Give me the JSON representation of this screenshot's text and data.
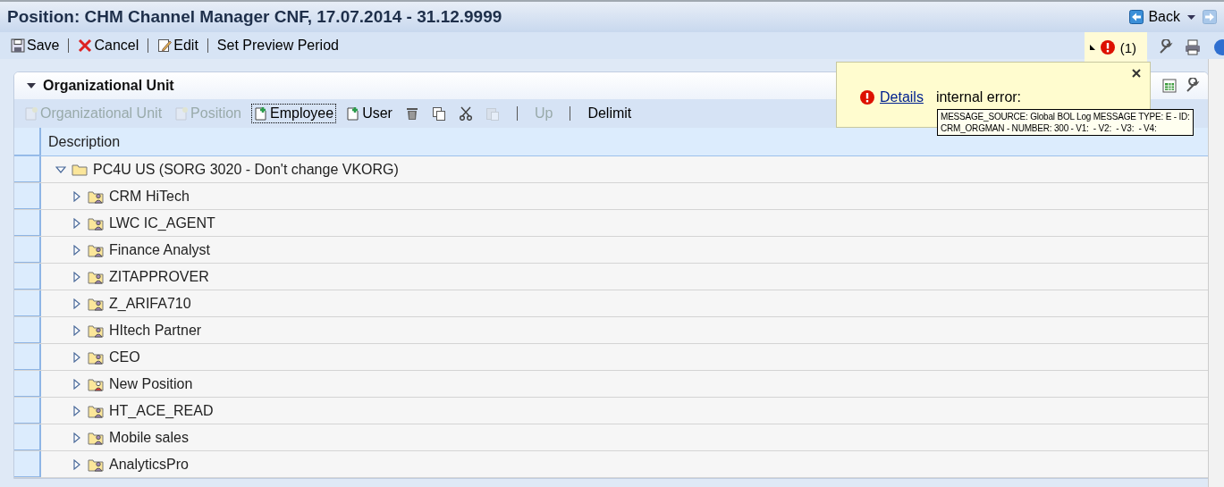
{
  "window": {
    "title": "Position: CHM Channel Manager CNF, 17.07.2014 - 31.12.9999",
    "back": "Back"
  },
  "toolbar": [
    {
      "kind": "save",
      "label": "Save"
    },
    {
      "kind": "cancel",
      "label": "Cancel"
    },
    {
      "kind": "edit",
      "label": "Edit"
    },
    {
      "kind": "none",
      "label": "Set Preview Period"
    }
  ],
  "messages": {
    "count": "(1)"
  },
  "panel": {
    "title": "Organizational Unit",
    "expanded": true,
    "actions": [
      {
        "kind": "new",
        "label": "Organizational Unit",
        "disabled": true,
        "focused": false
      },
      {
        "kind": "new",
        "label": "Position",
        "disabled": true,
        "focused": false
      },
      {
        "kind": "add",
        "label": "Employee",
        "disabled": false,
        "focused": true
      },
      {
        "kind": "add",
        "label": "User",
        "disabled": false,
        "focused": false
      },
      {
        "kind": "trash",
        "disabled": false,
        "focused": false
      },
      {
        "kind": "copy",
        "disabled": false,
        "focused": false
      },
      {
        "kind": "cut",
        "disabled": false,
        "focused": false
      },
      {
        "kind": "paste",
        "disabled": true,
        "focused": false
      },
      {
        "kind": "sep"
      },
      {
        "kind": "text",
        "label": "Up",
        "disabled": true,
        "focused": false
      },
      {
        "kind": "sep"
      },
      {
        "kind": "text",
        "label": "Delimit",
        "disabled": false,
        "focused": false
      }
    ],
    "table": {
      "columns": [
        "Description"
      ],
      "tree": [
        {
          "label": "PC4U US (SORG 3020 - Don't change VKORG)",
          "kind": "org",
          "expanded": true,
          "children": [
            {
              "label": "CRM HiTech",
              "kind": "position",
              "expanded": false
            },
            {
              "label": "LWC IC_AGENT",
              "kind": "position",
              "expanded": false
            },
            {
              "label": "Finance Analyst",
              "kind": "position",
              "expanded": false
            },
            {
              "label": "ZITAPPROVER",
              "kind": "position",
              "expanded": false
            },
            {
              "label": "Z_ARIFA710",
              "kind": "position",
              "expanded": false
            },
            {
              "label": "HItech Partner",
              "kind": "position",
              "expanded": false
            },
            {
              "label": "CEO",
              "kind": "position",
              "expanded": false
            },
            {
              "label": "New Position",
              "kind": "vacant",
              "expanded": false
            },
            {
              "label": "HT_ACE_READ",
              "kind": "position",
              "expanded": false
            },
            {
              "label": "Mobile sales",
              "kind": "position",
              "expanded": false
            },
            {
              "label": "AnalyticsPro",
              "kind": "position",
              "expanded": false
            }
          ]
        }
      ]
    }
  },
  "popup": {
    "link": "Details",
    "text": "internal error:",
    "tooltip": [
      "MESSAGE_SOURCE: Global BOL Log MESSAGE TYPE: E - ID:",
      "CRM_ORGMAN - NUMBER: 300 - V1:  - V2:  - V3:  - V4:"
    ]
  }
}
